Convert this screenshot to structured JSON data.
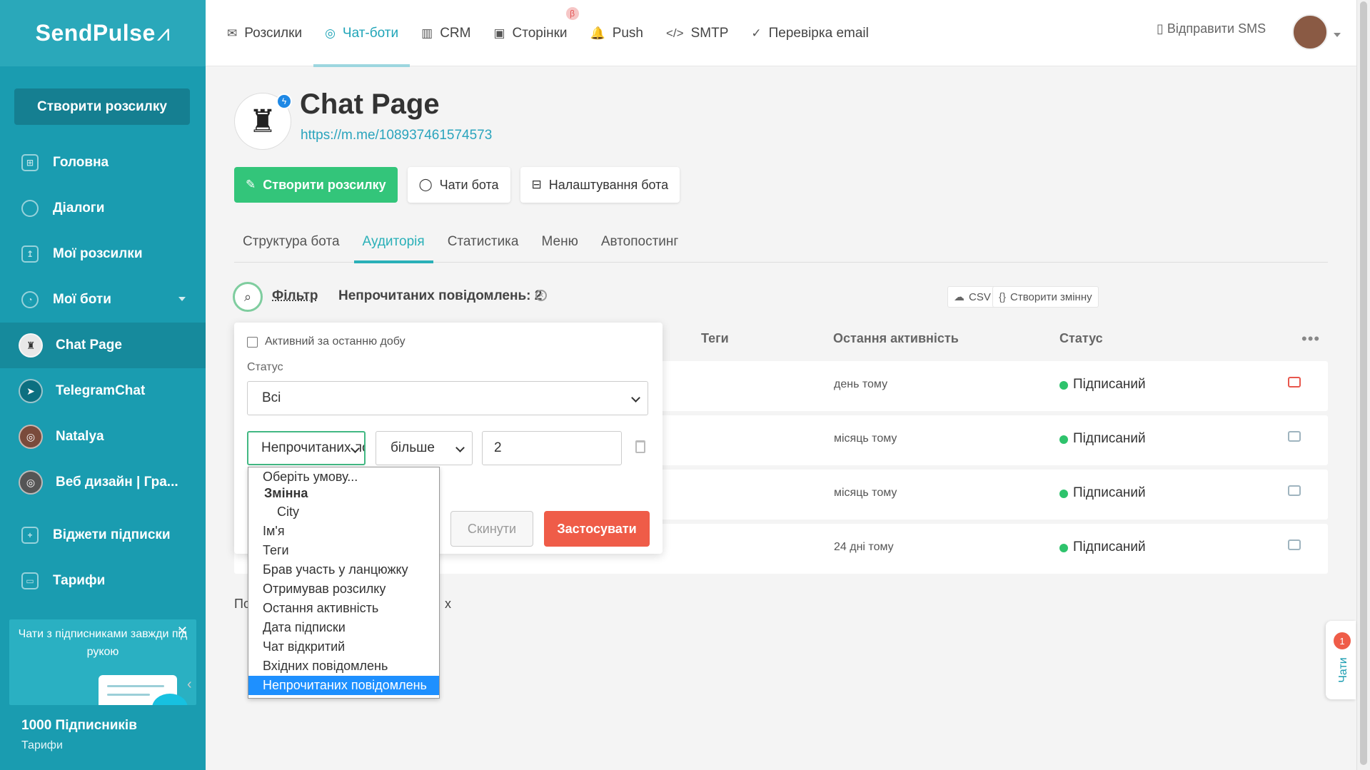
{
  "brand": {
    "name": "SendPulse",
    "pulse_glyph": "⩘"
  },
  "sidebar": {
    "create_label": "Створити розсилку",
    "items": [
      {
        "label": "Головна",
        "icon": "dashboard-icon"
      },
      {
        "label": "Діалоги",
        "icon": "chat-icon"
      },
      {
        "label": "Мої розсилки",
        "icon": "mailing-icon"
      },
      {
        "label": "Мої боти",
        "icon": "bot-icon"
      }
    ],
    "bots": [
      {
        "label": "Chat Page"
      },
      {
        "label": "TelegramChat"
      },
      {
        "label": "Natalya"
      },
      {
        "label": "Веб дизайн | Гра..."
      }
    ],
    "extra": [
      {
        "label": "Віджети підписки",
        "icon": "widget-icon"
      },
      {
        "label": "Тарифи",
        "icon": "wallet-icon"
      }
    ],
    "promo": {
      "text": "Чати з підписниками завжди під рукою",
      "close": "✕"
    },
    "subscribers": "1000 Підписників",
    "tariffs_link": "Тарифи"
  },
  "topnav": {
    "items": [
      {
        "label": "Розсилки",
        "icon": "✉"
      },
      {
        "label": "Чат-боти",
        "icon": "◎"
      },
      {
        "label": "CRM",
        "icon": "▥"
      },
      {
        "label": "Сторінки",
        "icon": "▣",
        "badge": "β"
      },
      {
        "label": "Push",
        "icon": "🔔"
      },
      {
        "label": "SMTP",
        "icon": "</>"
      },
      {
        "label": "Перевірка email",
        "icon": "✓"
      }
    ],
    "sms_label": "Відправити SMS"
  },
  "page": {
    "title": "Chat Page",
    "link": "https://m.me/108937461574573",
    "actions": {
      "create": "Створити розсилку",
      "chats": "Чати бота",
      "settings": "Налаштування бота"
    },
    "tabs": [
      "Структура бота",
      "Аудиторія",
      "Статистика",
      "Меню",
      "Автопостинг"
    ],
    "filter_label": "Фільтр",
    "unread_filter": "Непрочитаних повідомлень: 2",
    "csv": "CSV",
    "create_var": "Створити змінну"
  },
  "table": {
    "headers": {
      "tags": "Теги",
      "last_activity": "Остання активність",
      "status": "Статус",
      "more": "•••"
    },
    "rows": [
      {
        "activity": "день тому",
        "status": "Підписаний"
      },
      {
        "activity": "місяць тому",
        "status": "Підписаний"
      },
      {
        "activity": "місяць тому",
        "status": "Підписаний"
      },
      {
        "activity": "24 дні тому",
        "status": "Підписаний"
      }
    ],
    "page_info": {
      "start": "По",
      "end": "х"
    }
  },
  "filter_popup": {
    "active_day": "Активний за останню добу",
    "status_label": "Статус",
    "status_value": "Всі",
    "condition_value": "Непрочитаних повідомлень",
    "operator_value": "більше",
    "input_value": "2",
    "reset": "Скинути",
    "apply": "Застосувати"
  },
  "dropdown": {
    "placeholder": "Оберіть умову...",
    "group": "Змінна",
    "sub": "City",
    "options": [
      "Ім'я",
      "Теги",
      "Брав участь у ланцюжку",
      "Отримував розсилку",
      "Остання активність",
      "Дата підписки",
      "Чат відкритий",
      "Вхідних повідомлень",
      "Непрочитаних повідомлень"
    ]
  },
  "chats_widget": {
    "label": "Чати",
    "count": "1"
  }
}
